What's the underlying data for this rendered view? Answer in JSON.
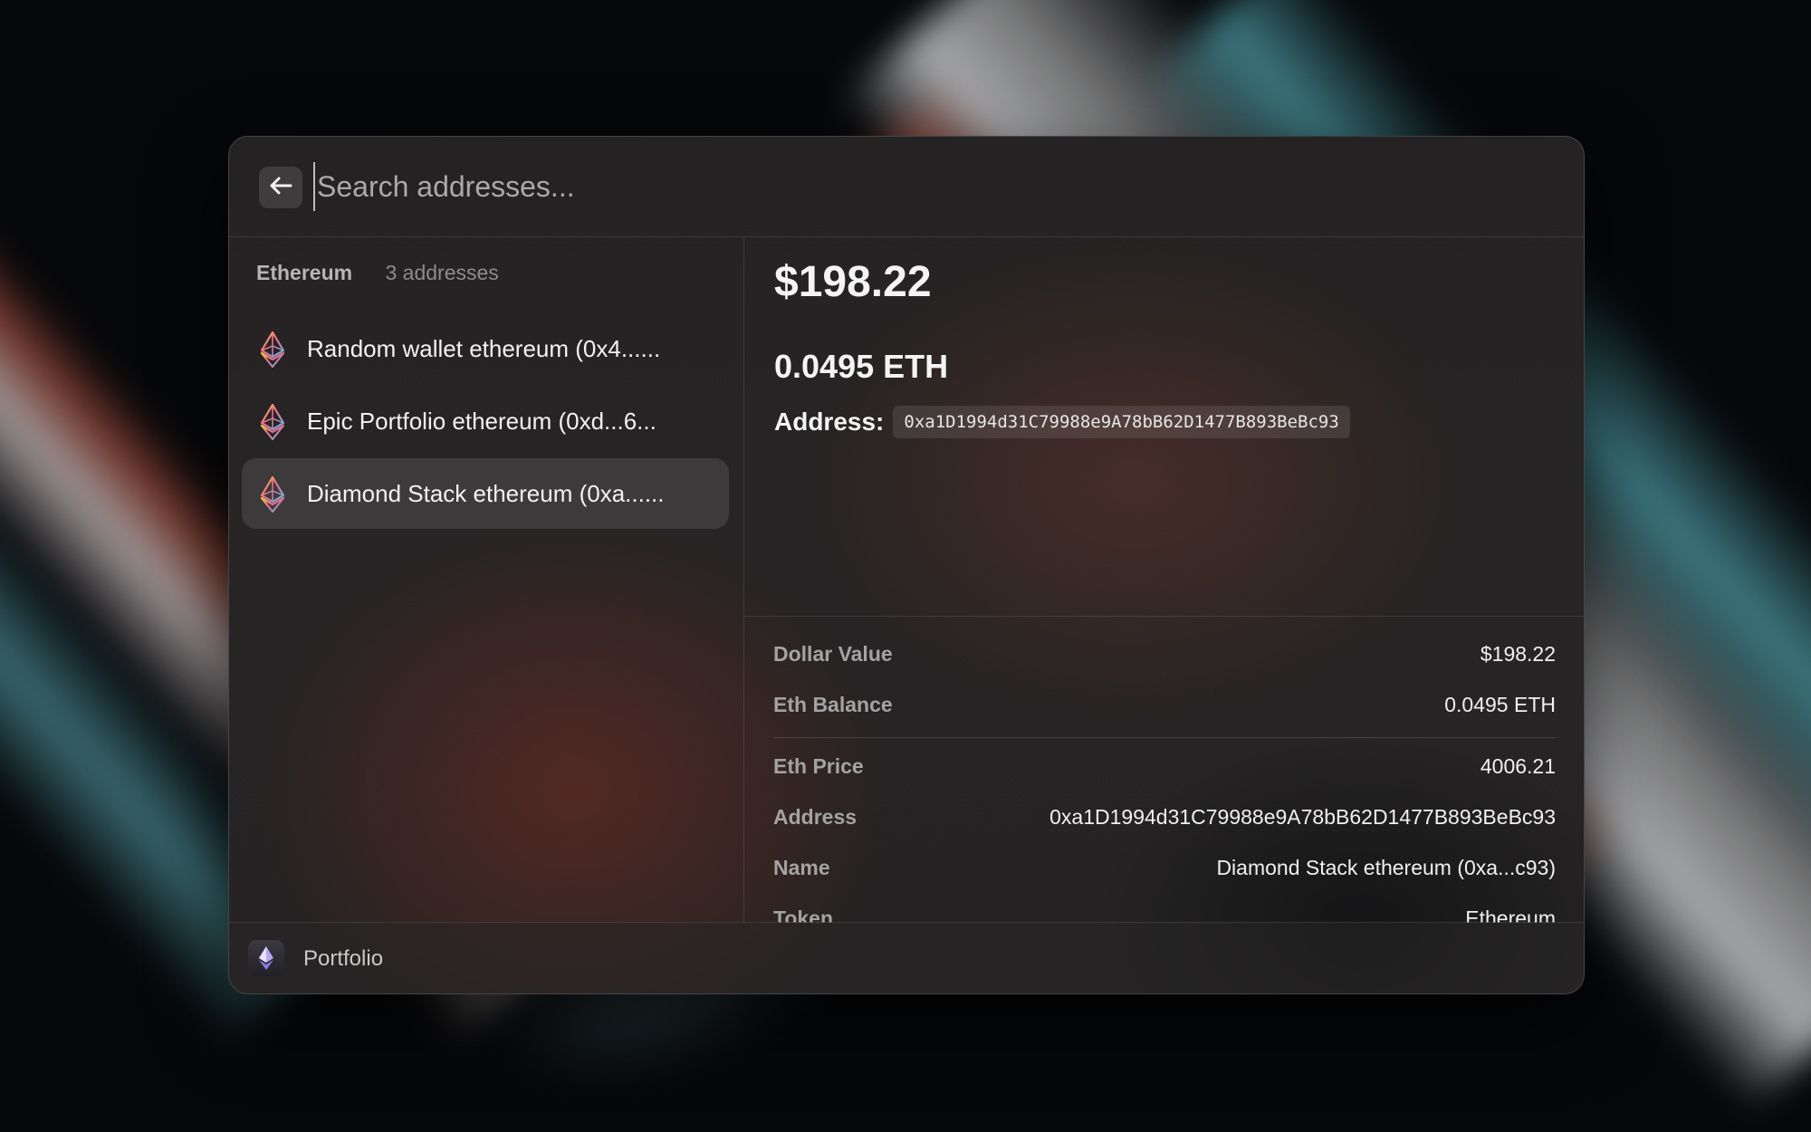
{
  "search": {
    "placeholder": "Search addresses...",
    "value": ""
  },
  "sidebar": {
    "section_title": "Ethereum",
    "section_count": "3 addresses",
    "items": [
      {
        "label": "Random wallet ethereum (0x4......",
        "icon": "ethereum-icon",
        "selected": false
      },
      {
        "label": "Epic Portfolio ethereum (0xd...6...",
        "icon": "ethereum-icon",
        "selected": false
      },
      {
        "label": "Diamond Stack ethereum (0xa......",
        "icon": "ethereum-icon",
        "selected": true
      }
    ]
  },
  "detail": {
    "dollar_value": "$198.22",
    "eth_value": "0.0495 ETH",
    "address_label": "Address:",
    "address_code": "0xa1D1994d31C79988e9A78bB62D1477B893BeBc93"
  },
  "metadata": {
    "rows": [
      {
        "key": "Dollar Value",
        "value": "$198.22"
      },
      {
        "key": "Eth Balance",
        "value": "0.0495 ETH"
      },
      {
        "key": "Eth Price",
        "value": "4006.21"
      },
      {
        "key": "Address",
        "value": "0xa1D1994d31C79988e9A78bB62D1477B893BeBc93"
      },
      {
        "key": "Name",
        "value": "Diamond Stack ethereum (0xa...c93)"
      },
      {
        "key": "Token",
        "value": "Ethereum"
      }
    ]
  },
  "footer": {
    "label": "Portfolio",
    "icon": "ethereum-icon"
  },
  "colors": {
    "window_bg": "#252323",
    "text_primary": "#f2f2f2",
    "text_muted": "#a3a3a3"
  }
}
